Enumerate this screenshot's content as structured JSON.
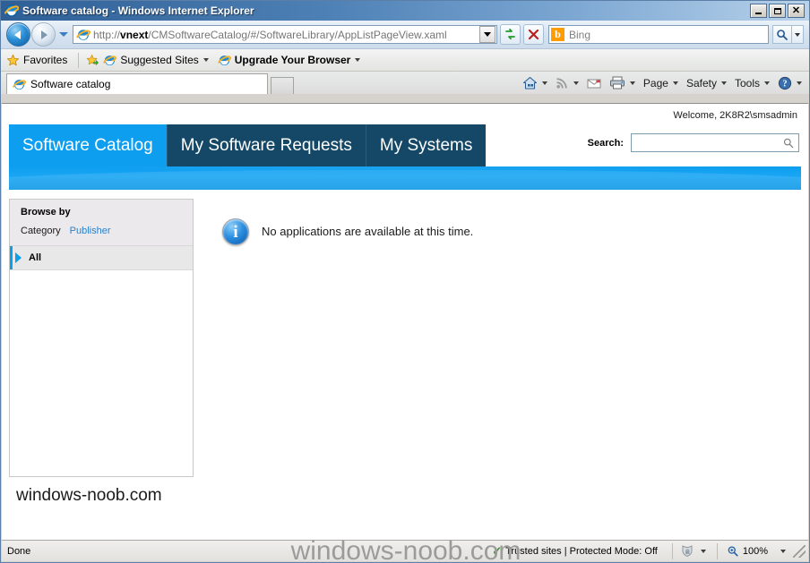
{
  "window": {
    "title": "Software catalog - Windows Internet Explorer",
    "minimize_label": "Minimize",
    "maximize_label": "Maximize",
    "close_label": "Close"
  },
  "navbar": {
    "back_label": "Back",
    "forward_label": "Forward",
    "recent_pages_label": "Recent Pages",
    "url_prefix": "http://",
    "url_host": "vnext",
    "url_path": "/CMSoftwareCatalog/#/SoftwareLibrary/AppListPageView.xaml",
    "refresh_label": "Refresh",
    "stop_label": "Stop",
    "search_provider": "Bing",
    "search_value": "",
    "search_go_label": "Search",
    "search_options_label": "Search Options"
  },
  "favorites_bar": {
    "favorites_label": "Favorites",
    "suggested_sites_label": "Suggested Sites",
    "upgrade_label": "Upgrade Your Browser"
  },
  "tabs": {
    "browser_tab_title": "Software catalog",
    "new_tab_label": "New Tab"
  },
  "command_bar": {
    "home_label": "Home",
    "feeds_label": "Feeds",
    "mail_label": "Read Mail",
    "print_label": "Print",
    "page_label": "Page",
    "safety_label": "Safety",
    "tools_label": "Tools",
    "help_label": "Help"
  },
  "page": {
    "welcome": "Welcome, 2K8R2\\smsadmin",
    "app_tabs": [
      {
        "label": "Software Catalog",
        "active": true
      },
      {
        "label": "My Software Requests",
        "active": false
      },
      {
        "label": "My Systems",
        "active": false
      }
    ],
    "search": {
      "label": "Search:",
      "value": "",
      "placeholder": "",
      "icon": "search-icon"
    },
    "sidebar": {
      "browse_by": "Browse by",
      "filter_category": "Category",
      "filter_publisher": "Publisher",
      "items": [
        {
          "label": "All",
          "selected": true
        }
      ]
    },
    "main": {
      "info_icon": "information-icon",
      "info_glyph": "i",
      "message": "No applications are available at this time."
    },
    "footer_text": "windows-noob.com"
  },
  "status_bar": {
    "status": "Done",
    "zone": "Trusted sites | Protected Mode: Off",
    "zoom": "100%"
  },
  "watermark": {
    "text": "windows-noob.com"
  },
  "colors": {
    "accent_blue": "#0d9eef",
    "tab_dark": "#144866",
    "link_blue": "#2a7fc9",
    "title_gradient_start": "#2e5f96",
    "title_gradient_end": "#b8d2ea"
  }
}
